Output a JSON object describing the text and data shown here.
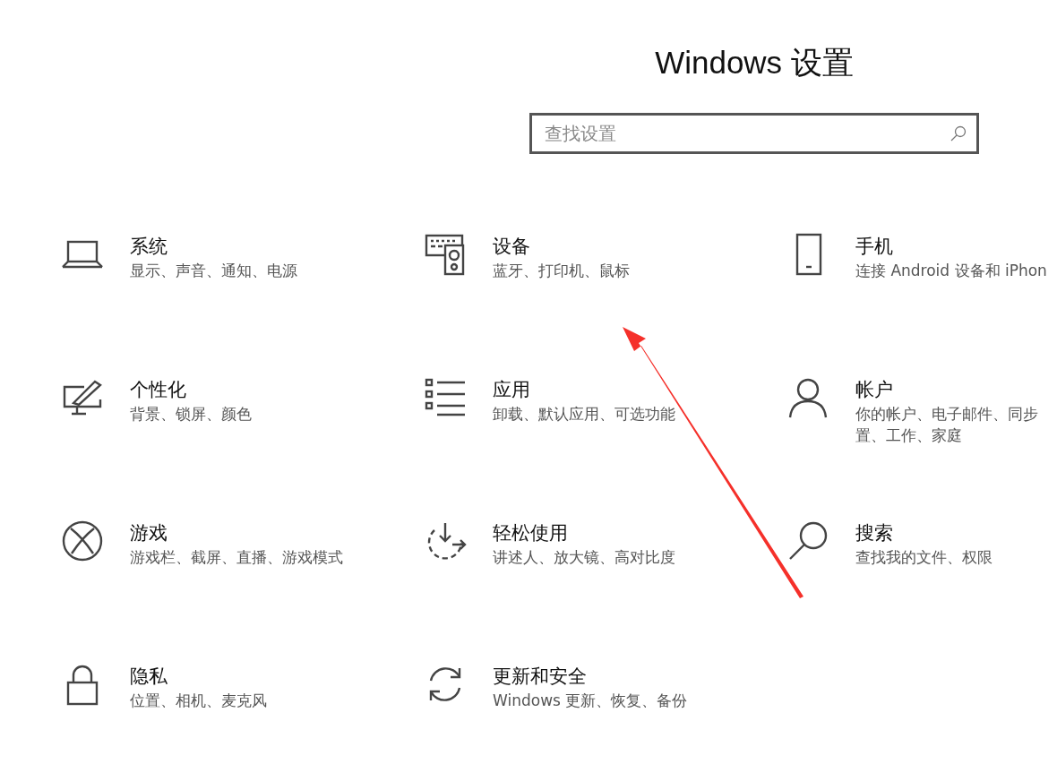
{
  "header": {
    "title": "Windows 设置"
  },
  "search": {
    "placeholder": "查找设置"
  },
  "tiles": [
    {
      "title": "系统",
      "description": [
        "显示、声音、通知、电源"
      ]
    },
    {
      "title": "设备",
      "description": [
        "蓝牙、打印机、鼠标"
      ]
    },
    {
      "title": "手机",
      "description": [
        "连接 Android 设备和 iPhon"
      ]
    },
    {
      "title": "个性化",
      "description": [
        "背景、锁屏、颜色"
      ]
    },
    {
      "title": "应用",
      "description": [
        "卸载、默认应用、可选功能"
      ]
    },
    {
      "title": "帐户",
      "description": [
        "你的帐户、电子邮件、同步",
        "置、工作、家庭"
      ]
    },
    {
      "title": "游戏",
      "description": [
        "游戏栏、截屏、直播、游戏模式"
      ]
    },
    {
      "title": "轻松使用",
      "description": [
        "讲述人、放大镜、高对比度"
      ]
    },
    {
      "title": "搜索",
      "description": [
        "查找我的文件、权限"
      ]
    },
    {
      "title": "隐私",
      "description": [
        "位置、相机、麦克风"
      ]
    },
    {
      "title": "更新和安全",
      "description": [
        "Windows 更新、恢复、备份"
      ]
    }
  ]
}
